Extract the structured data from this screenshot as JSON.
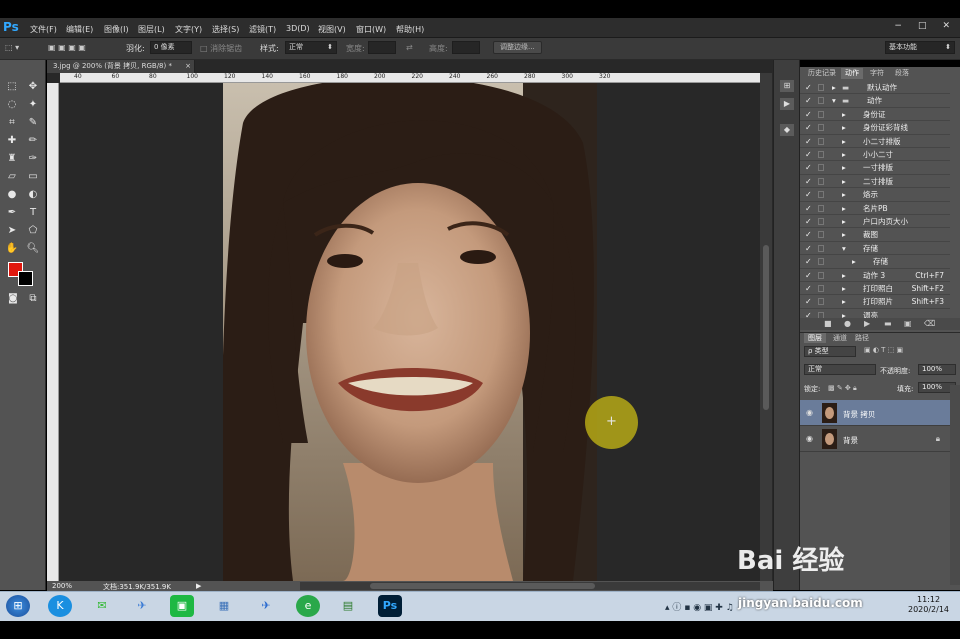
{
  "app": {
    "logo": "Ps"
  },
  "menu": [
    "文件(F)",
    "编辑(E)",
    "图像(I)",
    "图层(L)",
    "文字(Y)",
    "选择(S)",
    "滤镜(T)",
    "3D(D)",
    "视图(V)",
    "窗口(W)",
    "帮助(H)"
  ],
  "window_controls": {
    "minimize": "−",
    "restore": "□",
    "close": "✕"
  },
  "options": {
    "feather_label": "羽化:",
    "feather_value": "0 像素",
    "antialias_label": "消除锯齿",
    "style_label": "样式:",
    "style_value": "正常",
    "width_label": "宽度:",
    "swap_icon": "⇄",
    "height_label": "高度:",
    "refine_button": "调整边缘...",
    "workspace_value": "基本功能"
  },
  "document": {
    "tab_title": "3.jpg @ 200% (背景 拷贝, RGB/8) *",
    "tab_close": "×",
    "ruler_ticks": [
      "40",
      "60",
      "80",
      "100",
      "120",
      "140",
      "160",
      "180",
      "200",
      "220",
      "240",
      "260",
      "280",
      "300",
      "320"
    ],
    "zoom": "200%",
    "doc_size": "文档:351.9K/351.9K"
  },
  "actions_panel": {
    "tabs": [
      "历史记录",
      "动作",
      "字符",
      "段落"
    ],
    "active_tab": "动作",
    "rows": [
      {
        "name": "默认动作",
        "indent": 0,
        "folder": true,
        "shortcut": ""
      },
      {
        "name": "动作",
        "indent": 0,
        "folder": true,
        "shortcut": ""
      },
      {
        "name": "身份证",
        "indent": 1,
        "folder": false,
        "shortcut": ""
      },
      {
        "name": "身份证彩背线",
        "indent": 1,
        "folder": false,
        "shortcut": ""
      },
      {
        "name": "小二寸排版",
        "indent": 1,
        "folder": false,
        "shortcut": ""
      },
      {
        "name": "小小二寸",
        "indent": 1,
        "folder": false,
        "shortcut": ""
      },
      {
        "name": "一寸排版",
        "indent": 1,
        "folder": false,
        "shortcut": ""
      },
      {
        "name": "二寸排版",
        "indent": 1,
        "folder": false,
        "shortcut": ""
      },
      {
        "name": "烙示",
        "indent": 1,
        "folder": false,
        "shortcut": ""
      },
      {
        "name": "名片PB",
        "indent": 1,
        "folder": false,
        "shortcut": ""
      },
      {
        "name": "户口内页大小",
        "indent": 1,
        "folder": false,
        "shortcut": ""
      },
      {
        "name": "裁图",
        "indent": 1,
        "folder": false,
        "shortcut": ""
      },
      {
        "name": "存储",
        "indent": 1,
        "folder": false,
        "shortcut": ""
      },
      {
        "name": "存储",
        "indent": 2,
        "folder": false,
        "shortcut": ""
      },
      {
        "name": "动作 3",
        "indent": 1,
        "folder": false,
        "shortcut": "Ctrl+F7"
      },
      {
        "name": "打印照白",
        "indent": 1,
        "folder": false,
        "shortcut": "Shift+F2"
      },
      {
        "name": "打印照片",
        "indent": 1,
        "folder": false,
        "shortcut": "Shift+F3"
      },
      {
        "name": "调亮",
        "indent": 1,
        "folder": false,
        "shortcut": ""
      }
    ]
  },
  "layers_panel": {
    "tabs": [
      "图层",
      "通道",
      "路径"
    ],
    "active_tab": "图层",
    "kind_label": "ρ 类型",
    "blend_mode": "正常",
    "opacity_label": "不透明度:",
    "opacity_value": "100%",
    "lock_label": "锁定:",
    "fill_label": "填充:",
    "fill_value": "100%",
    "layers": [
      {
        "name": "背景 拷贝",
        "selected": true,
        "locked": false
      },
      {
        "name": "背景",
        "selected": false,
        "locked": true
      }
    ]
  },
  "taskbar": {
    "clock_time": "11:12",
    "clock_date": "2020/2/14"
  },
  "watermark": {
    "text": "Bai 经验",
    "url": "jingyan.baidu.com"
  },
  "colors": {
    "foreground": "#e0180e",
    "background": "#000000",
    "accent": "#31a8ff",
    "brush": "#c8b914"
  }
}
